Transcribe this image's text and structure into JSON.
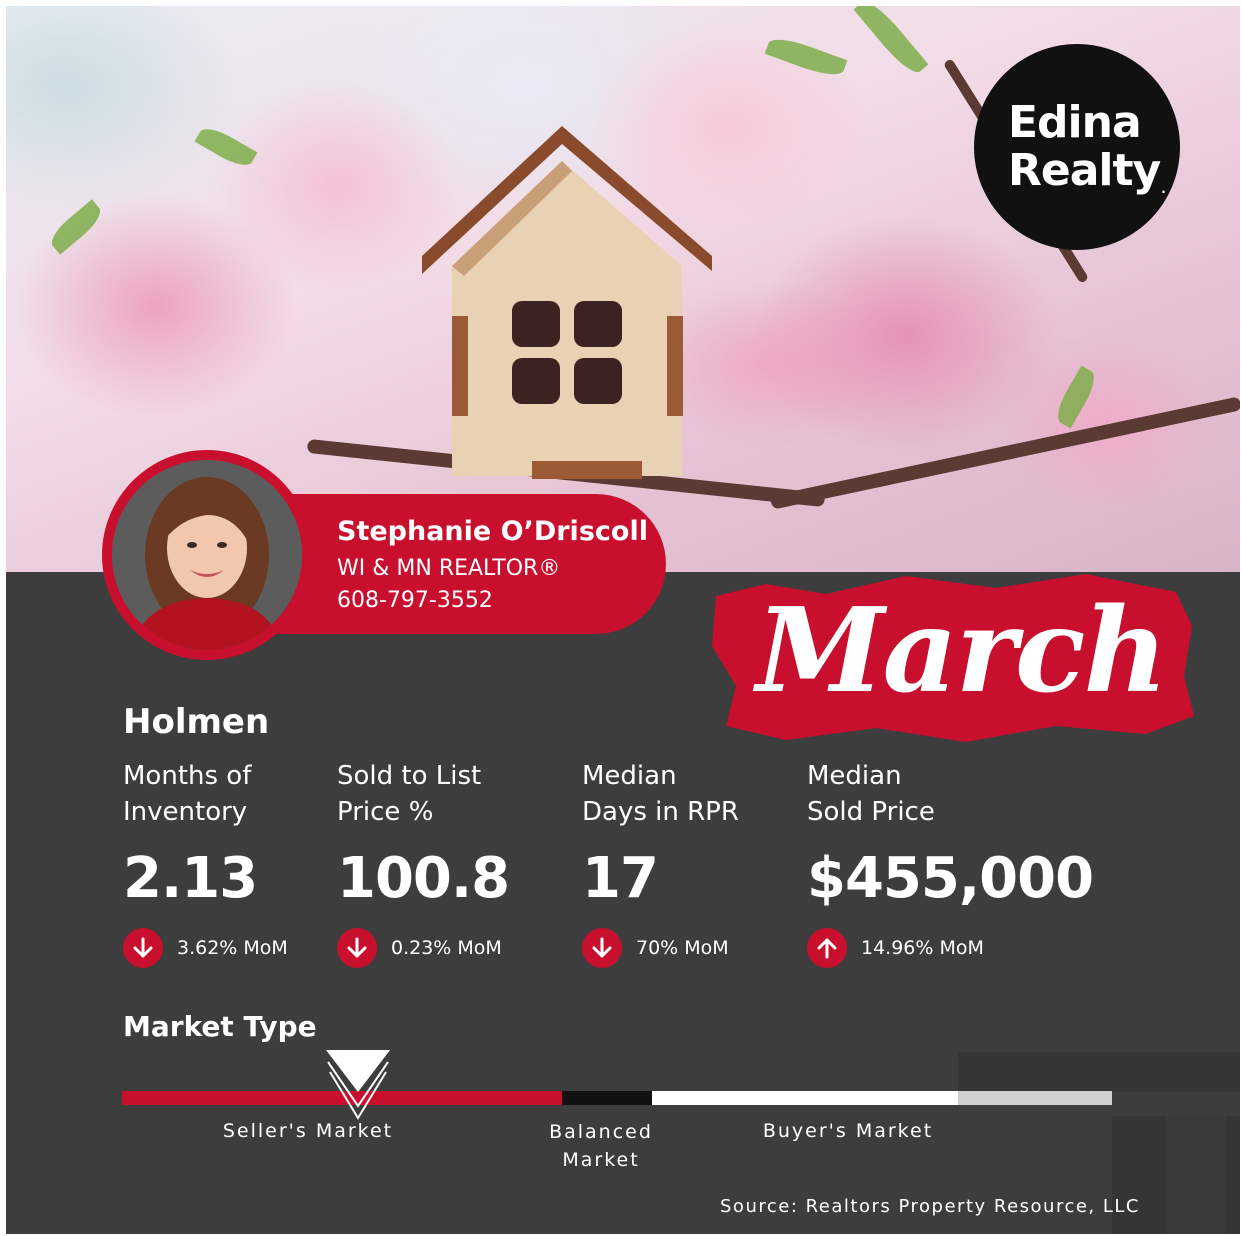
{
  "brand": {
    "line1": "Edina",
    "line2": "Realty",
    "reg_mark": "."
  },
  "agent": {
    "name": "Stephanie O’Driscoll",
    "title": "WI & MN REALTOR®",
    "phone": "608-797-3552"
  },
  "month": "March",
  "city": "Holmen",
  "stats": [
    {
      "label_line1": "Months of",
      "label_line2": "Inventory",
      "value": "2.13",
      "change": "3.62% MoM",
      "direction": "down"
    },
    {
      "label_line1": "Sold to List",
      "label_line2": "Price %",
      "value": "100.8",
      "change": "0.23% MoM",
      "direction": "down"
    },
    {
      "label_line1": "Median",
      "label_line2": "Days in RPR",
      "value": "17",
      "change": "70% MoM",
      "direction": "down"
    },
    {
      "label_line1": "Median",
      "label_line2": "Sold Price",
      "value": "$455,000",
      "change": "14.96% MoM",
      "direction": "up"
    }
  ],
  "market": {
    "title": "Market Type",
    "sellers": "Seller's Market",
    "balanced_line1": "Balanced",
    "balanced_line2": "Market",
    "buyers": "Buyer's Market",
    "indicator": "Seller's Market"
  },
  "source": "Source: Realtors Property Resource, LLC",
  "colors": {
    "accent": "#c8102e",
    "panel": "#3d3d3d",
    "logo_bg": "#111111"
  }
}
